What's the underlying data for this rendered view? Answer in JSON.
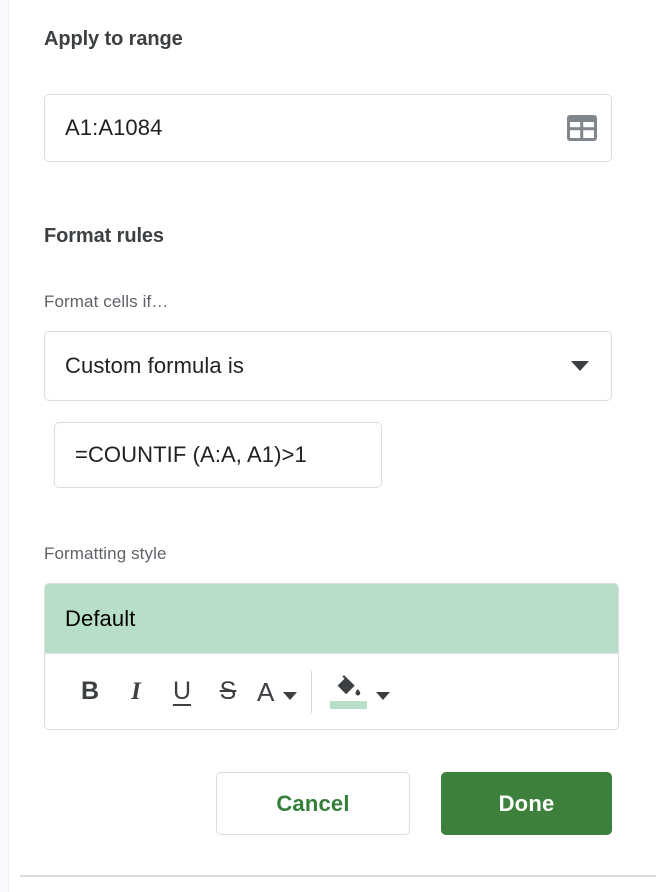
{
  "panel": {
    "apply_to_range": {
      "title": "Apply to range",
      "value": "A1:A1084",
      "picker_icon": "grid-table-icon"
    },
    "format_rules": {
      "title": "Format rules",
      "condition_label": "Format cells if…",
      "condition_value": "Custom formula is",
      "dropdown_icon": "chevron-down-icon",
      "formula_value": "=COUNTIF (A:A, A1)>1"
    },
    "formatting_style": {
      "label": "Formatting style",
      "preview_text": "Default",
      "preview_bg": "#b7dfc8",
      "toolbar": [
        {
          "name": "bold-button",
          "glyph": "B"
        },
        {
          "name": "italic-button",
          "glyph": "I"
        },
        {
          "name": "underline-button",
          "glyph": "U"
        },
        {
          "name": "strikethrough-button",
          "glyph": "S"
        },
        {
          "name": "text-color-button",
          "glyph": "A"
        },
        {
          "name": "fill-color-button",
          "glyph": "paint-bucket"
        }
      ],
      "fill_swatch_color": "#b7dfc8"
    },
    "footer": {
      "cancel_label": "Cancel",
      "done_label": "Done",
      "cancel_text_color": "#34803a",
      "done_bg_color": "#3c803c"
    }
  }
}
